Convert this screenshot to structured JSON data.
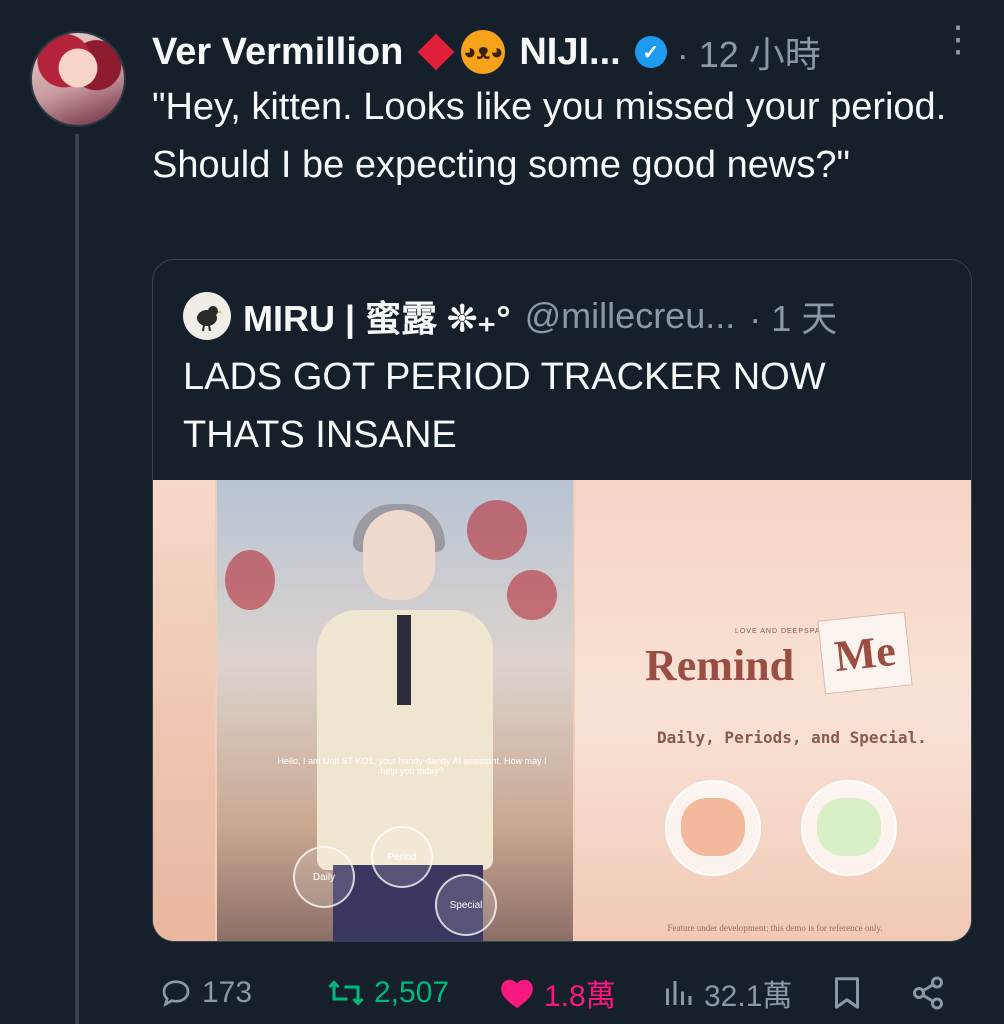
{
  "tweet": {
    "author": "Ver Vermillion",
    "affiliation_badge": "NIJI...",
    "time": "· 12 小時",
    "more": "⋮",
    "text": "\"Hey, kitten. Looks like you missed your period. Should I be expecting some good news?\""
  },
  "quote": {
    "name": "MIRU | 蜜露 ❊₊°",
    "handle": "@millecreu...",
    "time": "· 1 天",
    "text": "LADS GOT PERIOD TRACKER NOW THATS INSANE",
    "media": {
      "subtitle": "Hello, I am Unit ST-KO1, your handy-dandy AI assistant. How may I help you today?",
      "buttons": [
        "Daily",
        "Period",
        "Special"
      ],
      "kicker": "LOVE AND DEEPSPACE",
      "title_remind": "Remind",
      "title_me": "Me",
      "tagline": "Daily, Periods, and Special.",
      "disclaimer": "Feature under development; this demo is for reference only."
    }
  },
  "actions": {
    "replies": "173",
    "reposts": "2,507",
    "likes": "1.8萬",
    "views": "32.1萬"
  },
  "colors": {
    "background": "#15202b",
    "muted": "#8b98a5",
    "repost_active": "#00ba7c",
    "like_active": "#f91880",
    "verified": "#1d9bf0"
  }
}
